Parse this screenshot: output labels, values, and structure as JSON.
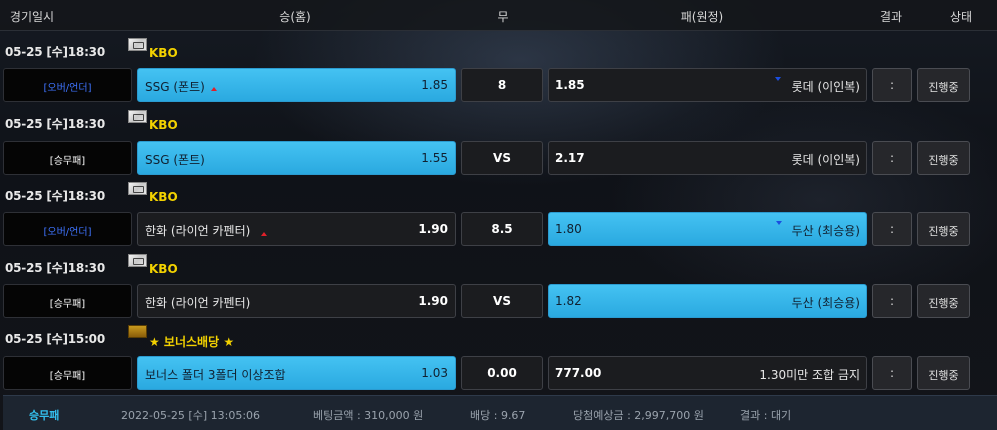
{
  "header": {
    "col_date": "경기일시",
    "col_home": "승(홈)",
    "col_draw": "무",
    "col_away": "패(원정)",
    "col_result": "결과",
    "col_status": "상태"
  },
  "games": [
    {
      "date": "05-25 [수]18:30",
      "league": "KBO",
      "league_icon": "korea-flag-icon",
      "bet_type": "[오버/언더]",
      "home_name": "SSG (폰트)",
      "home_odds": "1.85",
      "draw": "8",
      "away_odds": "1.85",
      "away_name": "롯데 (이인복)",
      "score": ":",
      "status": "진행중",
      "selected": "home"
    },
    {
      "date": "05-25 [수]18:30",
      "league": "KBO",
      "league_icon": "korea-flag-icon",
      "bet_type": "[승무패]",
      "home_name": "SSG (폰트)",
      "home_odds": "1.55",
      "draw": "VS",
      "away_odds": "2.17",
      "away_name": "롯데 (이인복)",
      "score": ":",
      "status": "진행중",
      "selected": "home"
    },
    {
      "date": "05-25 [수]18:30",
      "league": "KBO",
      "league_icon": "korea-flag-icon",
      "bet_type": "[오버/언더]",
      "home_name": "한화 (라이언 카펜터)",
      "home_odds": "1.90",
      "draw": "8.5",
      "away_odds": "1.80",
      "away_name": "두산 (최승용)",
      "score": ":",
      "status": "진행중",
      "selected": "away"
    },
    {
      "date": "05-25 [수]18:30",
      "league": "KBO",
      "league_icon": "korea-flag-icon",
      "bet_type": "[승무패]",
      "home_name": "한화 (라이언 카펜터)",
      "home_odds": "1.90",
      "draw": "VS",
      "away_odds": "1.82",
      "away_name": "두산 (최승용)",
      "score": ":",
      "status": "진행중",
      "selected": "away"
    },
    {
      "date": "05-25 [수]15:00",
      "league": "★ 보너스배당 ★",
      "league_icon": "bonus-icon",
      "bet_type": "[승무패]",
      "home_name": "보너스 폴더 3폴더 이상조합",
      "home_odds": "1.03",
      "draw": "0.00",
      "away_odds": "777.00",
      "away_name": "1.30미만 조합 금지",
      "score": ":",
      "status": "진행중",
      "selected": "home"
    }
  ],
  "footer": {
    "type": "승무패",
    "datetime": "2022-05-25 [수] 13:05:06",
    "bet_amount": "베팅금액 : 310,000 원",
    "odds": "배당 : 9.67",
    "expected": "당첨예상금 : 2,997,700 원",
    "result": "결과 : 대기"
  },
  "colors": {
    "selected_bg": "#2aa9e0",
    "league_text": "#f3d200",
    "over_under_text": "#3f74ff",
    "footer_type": "#34c0ef",
    "odds_up": "#e0202a",
    "odds_down": "#1a4ee0"
  }
}
